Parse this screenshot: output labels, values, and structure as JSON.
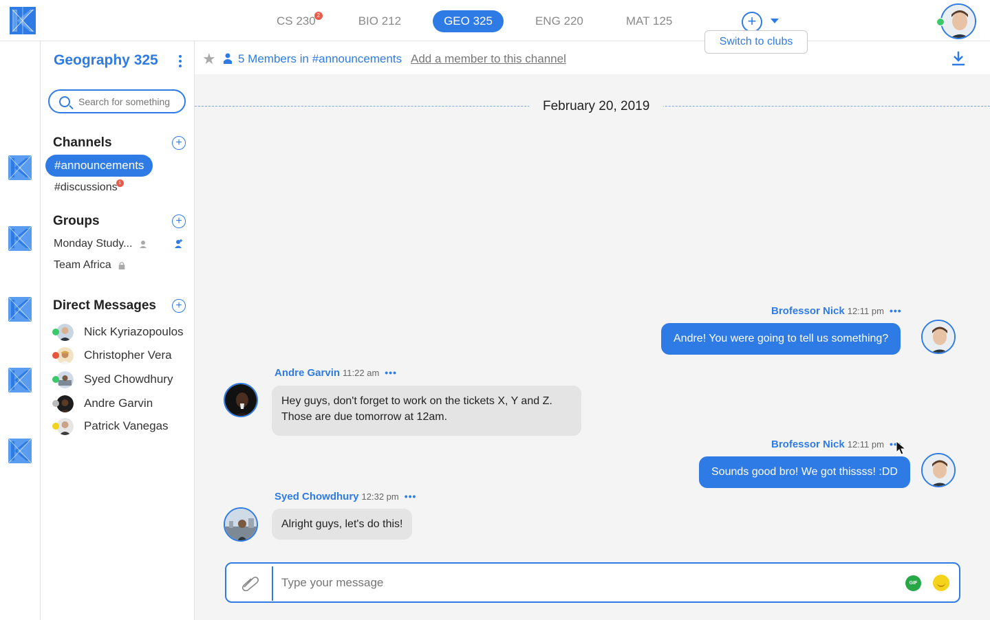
{
  "topbar": {
    "tabs": [
      {
        "label": "CS 230",
        "badge": "2"
      },
      {
        "label": "BIO 212"
      },
      {
        "label": "GEO 325",
        "active": true
      },
      {
        "label": "ENG 220"
      },
      {
        "label": "MAT 125"
      }
    ],
    "add_icon": "plus-circle-icon",
    "caret_icon": "chevron-down-icon",
    "tooltip": "Switch to clubs",
    "status_color": "#3cc96c"
  },
  "sidebar": {
    "course_title": "Geography 325",
    "search_placeholder": "Search for something",
    "channels_heading": "Channels",
    "channels": [
      {
        "label": "#announcements",
        "active": true
      },
      {
        "label": "#discussions",
        "badge": "1"
      }
    ],
    "groups_heading": "Groups",
    "groups": [
      {
        "label": "Monday Study...",
        "icon": "person-icon"
      },
      {
        "label": "Team Africa",
        "icon": "lock-icon"
      }
    ],
    "dm_heading": "Direct Messages",
    "dms": [
      {
        "name": "Nick Kyriazopoulos",
        "status": "#3cc96c"
      },
      {
        "name": "Christopher Vera",
        "status": "#e8553f"
      },
      {
        "name": "Syed Chowdhury",
        "status": "#3cc96c"
      },
      {
        "name": "Andre Garvin",
        "status": "#bbbbbb"
      },
      {
        "name": "Patrick Vanegas",
        "status": "#f2d21a"
      }
    ]
  },
  "channel_bar": {
    "members_text": "5 Members in #announcements",
    "add_member_text": "Add a member to this channel"
  },
  "chat": {
    "date": "February 20, 2019",
    "messages": [
      {
        "author": "Brofessor Nick",
        "time": "12:11 pm",
        "text": "Andre! You were going to tell us something?",
        "side": "right"
      },
      {
        "author": "Andre Garvin",
        "time": "11:22 am",
        "line1": "Hey guys, don't forget to work on the tickets X, Y and Z.",
        "line2": "Those are due tomorrow at 12am.",
        "side": "left"
      },
      {
        "author": "Brofessor Nick",
        "time": "12:11 pm",
        "text": "Sounds good bro! We got thissss! :DD",
        "side": "right"
      },
      {
        "author": "Syed Chowdhury",
        "time": "12:32 pm",
        "text": "Alright guys, let's do this!",
        "side": "left"
      }
    ],
    "dots": "•••"
  },
  "composer": {
    "placeholder": "Type your message",
    "gif_label": "GIF"
  },
  "colors": {
    "accent": "#2f7be5",
    "badge": "#e85b4b"
  }
}
